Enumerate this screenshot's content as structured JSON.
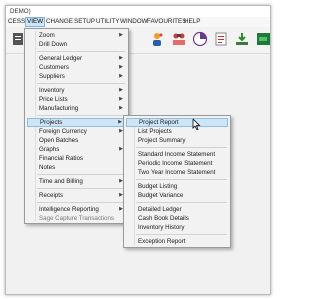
{
  "window": {
    "title": "DEMO)"
  },
  "menubar": {
    "items": [
      {
        "label": "CESS"
      },
      {
        "label": "VIEW"
      },
      {
        "label": "CHANGE"
      },
      {
        "label": "SETUP"
      },
      {
        "label": "UTILITY"
      },
      {
        "label": "WINDOW"
      },
      {
        "label": "FAVOURITES"
      },
      {
        "label": "HELP"
      }
    ],
    "active": "VIEW"
  },
  "toolbar": {
    "icons": [
      "document-icon",
      "person-icon",
      "people-icon",
      "chart-pie-icon",
      "report-icon",
      "download-icon",
      "excel-icon"
    ]
  },
  "view_menu": {
    "items": [
      {
        "label": "Zoom",
        "submenu": true
      },
      {
        "label": "Drill Down",
        "submenu": false
      },
      {
        "label": "General Ledger",
        "submenu": true
      },
      {
        "label": "Customers",
        "submenu": true
      },
      {
        "label": "Suppliers",
        "submenu": true
      },
      {
        "label": "Inventory",
        "submenu": true
      },
      {
        "label": "Price Lists",
        "submenu": true
      },
      {
        "label": "Manufacturing",
        "submenu": true
      },
      {
        "label": "Projects",
        "submenu": true,
        "highlighted": true
      },
      {
        "label": "Foreign Currency",
        "submenu": true
      },
      {
        "label": "Open Batches",
        "submenu": false
      },
      {
        "label": "Graphs",
        "submenu": true
      },
      {
        "label": "Financial Ratios",
        "submenu": false
      },
      {
        "label": "Notes",
        "submenu": false
      },
      {
        "label": "Time and Billing",
        "submenu": true
      },
      {
        "label": "Receipts",
        "submenu": true
      },
      {
        "label": "Intelligence Reporting",
        "submenu": true
      },
      {
        "label": "Sage Capture Transactions",
        "submenu": false,
        "disabled": true
      }
    ]
  },
  "projects_submenu": {
    "items": [
      {
        "label": "Project Report",
        "highlighted": true
      },
      {
        "label": "List Projects"
      },
      {
        "label": "Project Summary"
      },
      {
        "label": "Standard Income Statement"
      },
      {
        "label": "Periodic Income Statement"
      },
      {
        "label": "Two Year Income Statement"
      },
      {
        "label": "Budget Listing"
      },
      {
        "label": "Budget Variance"
      },
      {
        "label": "Detailed Ledger"
      },
      {
        "label": "Cash Book Details"
      },
      {
        "label": "Inventory History"
      },
      {
        "label": "Exception Report"
      }
    ]
  },
  "colors": {
    "highlight": "#cfe5f6",
    "highlight_border": "#8dbfe4",
    "menu_bg": "#f2f2f2"
  }
}
